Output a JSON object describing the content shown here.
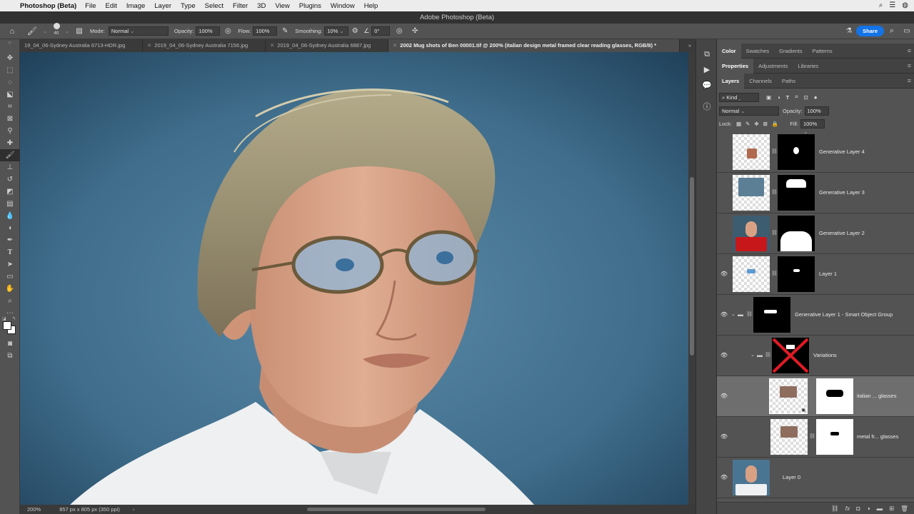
{
  "menubar": {
    "app": "Photoshop (Beta)",
    "items": [
      "File",
      "Edit",
      "Image",
      "Layer",
      "Type",
      "Select",
      "Filter",
      "3D",
      "View",
      "Plugins",
      "Window",
      "Help"
    ]
  },
  "window": {
    "title": "Adobe Photoshop (Beta)"
  },
  "options": {
    "brush_size": "40",
    "mode_label": "Mode:",
    "mode_value": "Normal",
    "opacity_label": "Opacity:",
    "opacity_value": "100%",
    "flow_label": "Flow:",
    "flow_value": "100%",
    "smoothing_label": "Smoothing:",
    "smoothing_value": "10%",
    "angle_value": "0°",
    "share_label": "Share"
  },
  "tabs": [
    {
      "label": "19_04_06-Sydney Australia 6713-HDR.jpg",
      "active": false
    },
    {
      "label": "2019_04_06-Sydney Australia 7156.jpg",
      "active": false
    },
    {
      "label": "2019_04_06-Sydney Australia 6887.jpg",
      "active": false
    },
    {
      "label": "2002 Mug shots of Ben 00001.tif @ 200% (italian design metal framed clear reading glasses, RGB/8) *",
      "active": true
    }
  ],
  "status": {
    "zoom": "200%",
    "doc_info": "857 px x 805 px (350 ppi)"
  },
  "panels": {
    "top_tabs": [
      "Color",
      "Swatches",
      "Gradients",
      "Patterns"
    ],
    "mid_tabs": [
      "Properties",
      "Adjustments",
      "Libraries"
    ],
    "layer_tabs": [
      "Layers",
      "Channels",
      "Paths"
    ],
    "kind_label": "Kind",
    "blend_mode": "Normal",
    "opacity_label": "Opacity:",
    "opacity_value": "100%",
    "lock_label": "Lock:",
    "fill_label": "Fill:",
    "fill_value": "100%"
  },
  "layers": [
    {
      "name": "Generative Layer 4",
      "visible": false,
      "selected": false
    },
    {
      "name": "Generative Layer 3",
      "visible": false,
      "selected": false
    },
    {
      "name": "Generative Layer 2",
      "visible": false,
      "selected": false
    },
    {
      "name": "Layer 1",
      "visible": true,
      "selected": false
    },
    {
      "name": "Generative Layer 1 - Smart Object Group",
      "visible": true,
      "selected": false
    },
    {
      "name": "Variations",
      "visible": true,
      "selected": false
    },
    {
      "name": "italian ... glasses",
      "visible": true,
      "selected": true
    },
    {
      "name": "metal fr... glasses",
      "visible": true,
      "selected": false
    },
    {
      "name": "Layer 0",
      "visible": true,
      "selected": false
    }
  ],
  "colors": {
    "accent": "#1473e6",
    "panel_bg": "#535353",
    "canvas_bg": "#3e6a88"
  }
}
